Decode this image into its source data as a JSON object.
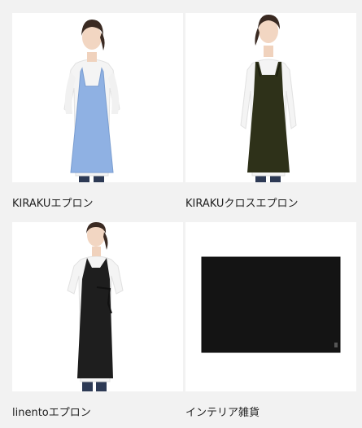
{
  "products": [
    {
      "name": "KIRAKUエプロン",
      "image": "apron-image",
      "apron_color": "#8fb1e3"
    },
    {
      "name": "KIRAKUクロスエプロン",
      "image": "apron-image",
      "apron_color": "#2e3119"
    },
    {
      "name": "linentoエプロン",
      "image": "apron-image",
      "apron_color": "#1e1e1e"
    },
    {
      "name": "インテリア雑貨",
      "image": "cloth-image",
      "apron_color": "#141414"
    }
  ]
}
